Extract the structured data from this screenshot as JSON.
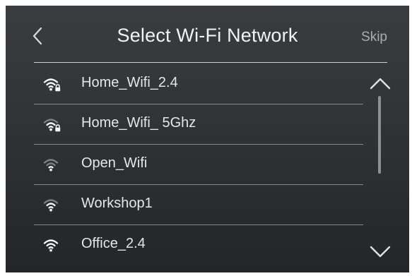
{
  "header": {
    "title": "Select Wi-Fi Network",
    "skip_label": "Skip"
  },
  "networks": [
    {
      "ssid": "Home_Wifi_2.4",
      "secured": true,
      "signal": 3
    },
    {
      "ssid": "Home_Wifi_ 5Ghz",
      "secured": true,
      "signal": 2
    },
    {
      "ssid": "Open_Wifi",
      "secured": false,
      "signal": 1
    },
    {
      "ssid": "Workshop1",
      "secured": false,
      "signal": 2
    },
    {
      "ssid": "Office_2.4",
      "secured": false,
      "signal": 3
    }
  ],
  "scroll": {
    "position": 0,
    "visible_fraction": 1.0
  },
  "icons": {
    "back": "chevron-left-icon",
    "scroll_up": "chevron-up-icon",
    "scroll_down": "chevron-down-icon",
    "wifi": "wifi-icon",
    "lock": "lock-icon"
  },
  "colors": {
    "background_top": "#3a3d40",
    "background_bottom": "#232528",
    "text": "#e4e6e7",
    "muted": "#a9adb0",
    "divider": "#84888c"
  }
}
